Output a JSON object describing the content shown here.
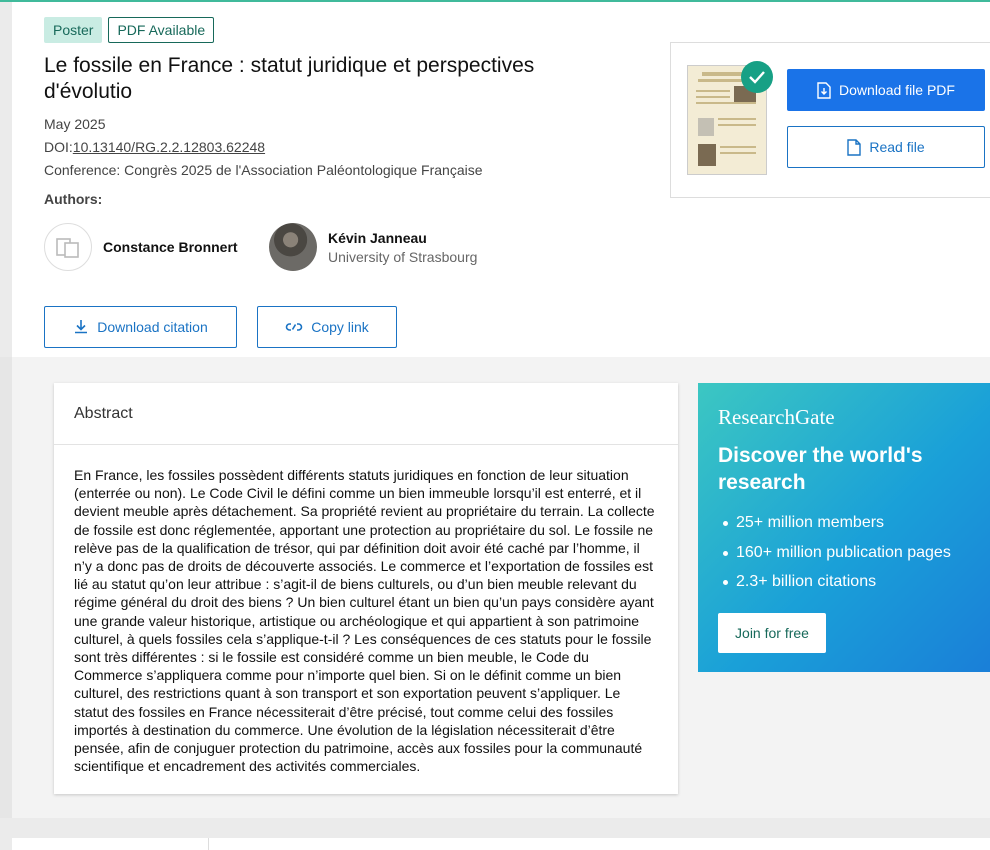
{
  "badges": {
    "poster": "Poster",
    "pdf": "PDF Available"
  },
  "publication": {
    "title": "Le fossile en France : statut juridique et perspectives d'évolutio",
    "date": "May 2025",
    "doi_label": "DOI:",
    "doi": "10.13140/RG.2.2.12803.62248",
    "conference": "Conference: Congrès 2025 de l'Association Paléontologique Française"
  },
  "authors": {
    "label": "Authors:",
    "list": [
      {
        "name": "Constance Bronnert",
        "institution": ""
      },
      {
        "name": "Kévin Janneau",
        "institution": "University of Strasbourg"
      }
    ]
  },
  "actions": {
    "download_citation": "Download citation",
    "copy_link": "Copy link"
  },
  "file": {
    "download_pdf": "Download file PDF",
    "read_file": "Read file"
  },
  "abstract": {
    "heading": "Abstract",
    "text": "En France, les fossiles possèdent différents statuts juridiques en fonction de leur situation (enterrée ou non). Le Code Civil le défini comme un bien immeuble lorsqu’il est enterré, et il devient meuble après détachement. Sa propriété revient au propriétaire du terrain. La collecte de fossile est donc réglementée, apportant une protection au propriétaire du sol. Le fossile ne relève pas de la qualification de trésor, qui par définition doit avoir été caché par l’homme, il n’y a donc pas de droits de découverte associés. Le commerce et l’exportation de fossiles est lié au statut qu’on leur attribue : s’agit-il de biens culturels, ou d’un bien meuble relevant du régime général du droit des biens ? Un bien culturel étant un bien qu’un pays considère ayant une grande valeur historique, artistique ou archéologique et qui appartient à son patrimoine culturel, à quels fossiles cela s’applique-t-il ? Les conséquences de ces statuts pour le fossile sont très différentes : si le fossile est considéré comme un bien meuble, le Code du Commerce s’appliquera comme pour n’importe quel bien. Si on le définit comme un bien culturel, des restrictions quant à son transport et son exportation peuvent s’appliquer. Le statut des fossiles en France nécessiterait d’être précisé, tout comme celui des fossiles importés à destination du commerce. Une évolution de la législation nécessiterait d’être pensée, afin de conjuguer protection du patrimoine, accès aux fossiles pour la communauté scientifique et encadrement des activités commerciales."
  },
  "promo": {
    "logo": "ResearchGate",
    "title": "Discover the world's research",
    "bullets": [
      "25+ million members",
      "160+ million publication pages",
      "2.3+ billion citations"
    ],
    "join": "Join for free"
  },
  "colors": {
    "accent": "#1a73e8",
    "brand_green": "#17695a",
    "check": "#17a085"
  }
}
